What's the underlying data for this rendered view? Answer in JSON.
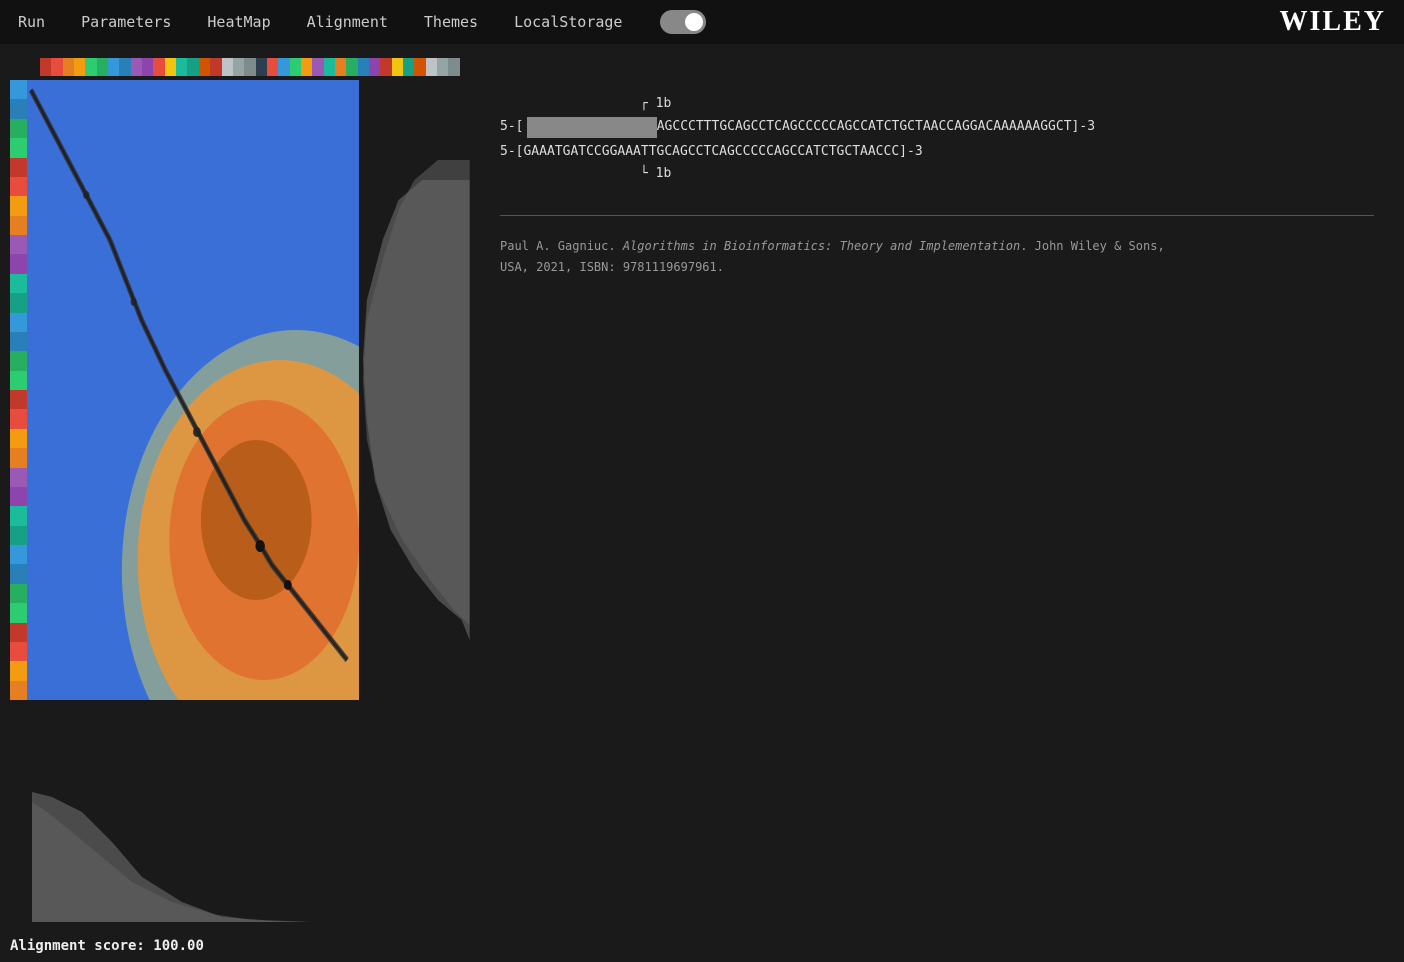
{
  "navbar": {
    "items": [
      "Run",
      "Parameters",
      "HeatMap",
      "Alignment",
      "Themes",
      "LocalStorage"
    ],
    "logo": "WILEY"
  },
  "colorbar": {
    "colors": [
      "#c0392b",
      "#e74c3c",
      "#e67e22",
      "#f39c12",
      "#2ecc71",
      "#27ae60",
      "#3498db",
      "#2980b9",
      "#9b59b6",
      "#8e44ad",
      "#e74c3c",
      "#f1c40f",
      "#1abc9c",
      "#16a085",
      "#d35400",
      "#c0392b",
      "#bdc3c7",
      "#95a5a6",
      "#7f8c8d",
      "#2c3e50",
      "#e74c3c",
      "#3498db",
      "#2ecc71",
      "#f39c12",
      "#9b59b6",
      "#1abc9c",
      "#e67e22",
      "#27ae60",
      "#2980b9",
      "#8e44ad",
      "#c0392b",
      "#f1c40f",
      "#16a085",
      "#d35400",
      "#bdc3c7",
      "#95a5a6",
      "#7f8c8d"
    ]
  },
  "sidestrip": {
    "colors": [
      "#3498db",
      "#2980b9",
      "#27ae60",
      "#2ecc71",
      "#c0392b",
      "#e74c3c",
      "#f39c12",
      "#e67e22",
      "#9b59b6",
      "#8e44ad",
      "#1abc9c",
      "#16a085",
      "#3498db",
      "#2980b9",
      "#27ae60",
      "#2ecc71",
      "#c0392b",
      "#e74c3c",
      "#f39c12",
      "#e67e22",
      "#9b59b6",
      "#8e44ad",
      "#1abc9c",
      "#16a085",
      "#3498db",
      "#2980b9",
      "#27ae60",
      "#2ecc71",
      "#c0392b",
      "#e74c3c",
      "#f39c12",
      "#e67e22"
    ]
  },
  "sequence": {
    "label_top": "1b",
    "seq1_prefix": "5-[",
    "seq1_content": "AGCCCTTTGCAGCCTCAGCCCCCAGCCATCTGCTAACCAGGACAAAAAAGGCT",
    "seq1_suffix": "]-3",
    "seq2_prefix": "5-[GAAATGATCCGGAAATTGCAGCCTCAGCCCCCAGCCATCTGCTAACCC",
    "seq2_suffix": "]-3",
    "label_bottom": "1b"
  },
  "citation": {
    "text": "Paul A. Gagniuc. Algorithms in Bioinformatics: Theory and Implementation. John Wiley & Sons, USA, 2021, ISBN: 9781119697961."
  },
  "alignment_score": {
    "label": "Alignment score:",
    "value": "100.00"
  }
}
